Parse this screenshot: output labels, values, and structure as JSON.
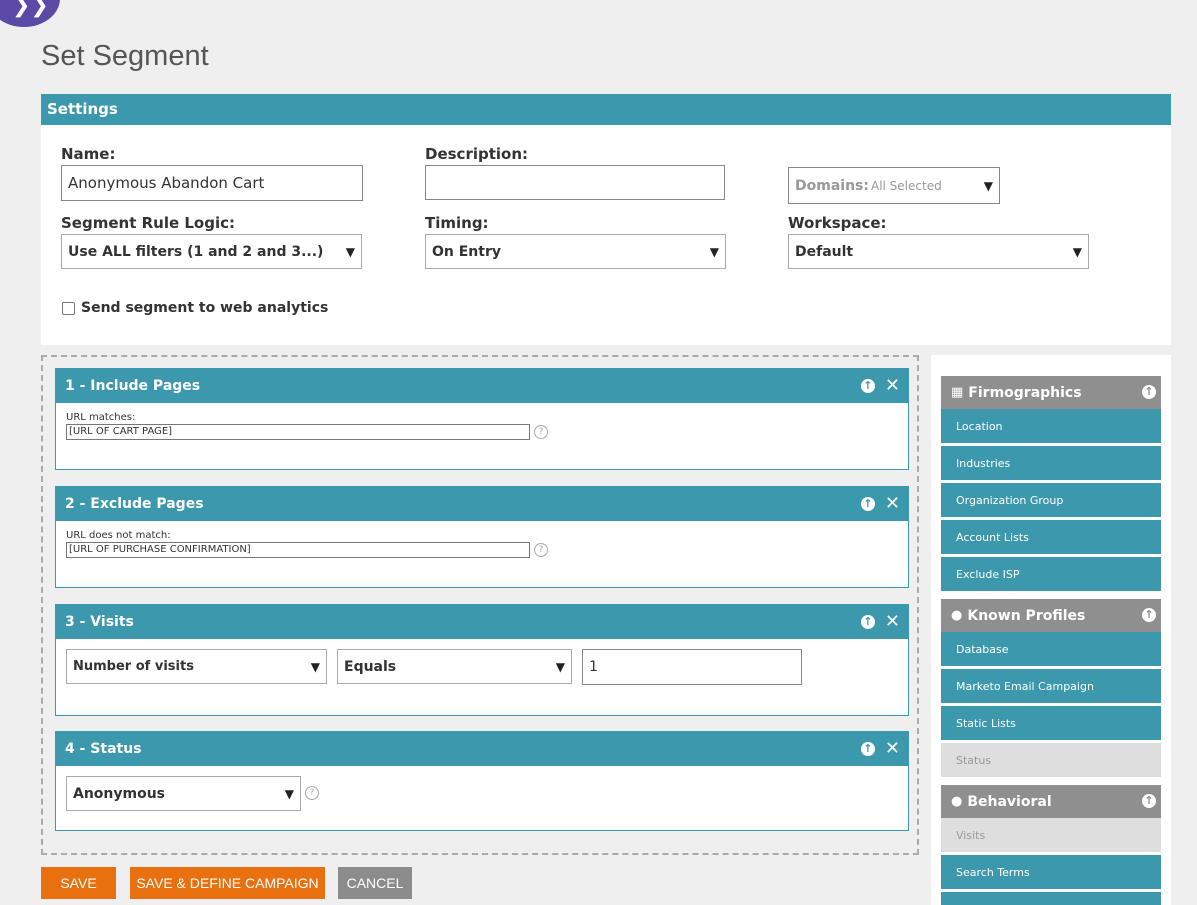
{
  "page": {
    "title": "Set Segment"
  },
  "settings": {
    "header": "Settings",
    "name_label": "Name:",
    "name_value": "Anonymous Abandon Cart",
    "description_label": "Description:",
    "description_value": "",
    "domains_label": "Domains:",
    "domains_value": "All Selected",
    "rule_logic_label": "Segment Rule Logic:",
    "rule_logic_value": "Use ALL filters (1 and 2 and 3...)",
    "timing_label": "Timing:",
    "timing_value": "On Entry",
    "workspace_label": "Workspace:",
    "workspace_value": "Default",
    "web_analytics_label": "Send segment to web analytics",
    "web_analytics_checked": false
  },
  "filters": [
    {
      "title": "1 - Include Pages",
      "field_label": "URL matches:",
      "field_value": "[URL OF CART PAGE]"
    },
    {
      "title": "2 - Exclude Pages",
      "field_label": "URL does not match:",
      "field_value": "[URL OF PURCHASE CONFIRMATION]"
    },
    {
      "title": "3 - Visits",
      "metric": "Number of visits",
      "operator": "Equals",
      "value": "1"
    },
    {
      "title": "4 - Status",
      "status": "Anonymous"
    }
  ],
  "buttons": {
    "save": "SAVE",
    "save_define": "SAVE & DEFINE CAMPAIGN",
    "cancel": "CANCEL"
  },
  "sidebar": {
    "sections": [
      {
        "title": "Firmographics",
        "icon": "building-icon",
        "items": [
          {
            "label": "Location",
            "enabled": true
          },
          {
            "label": "Industries",
            "enabled": true
          },
          {
            "label": "Organization Group",
            "enabled": true
          },
          {
            "label": "Account Lists",
            "enabled": true
          },
          {
            "label": "Exclude ISP",
            "enabled": true
          }
        ]
      },
      {
        "title": "Known Profiles",
        "icon": "person-icon",
        "items": [
          {
            "label": "Database",
            "enabled": true
          },
          {
            "label": "Marketo Email Campaign",
            "enabled": true
          },
          {
            "label": "Static Lists",
            "enabled": true
          },
          {
            "label": "Status",
            "enabled": false
          }
        ]
      },
      {
        "title": "Behavioral",
        "icon": "people-icon",
        "items": [
          {
            "label": "Visits",
            "enabled": false
          },
          {
            "label": "Search Terms",
            "enabled": true
          }
        ]
      }
    ]
  },
  "colors": {
    "teal": "#3c98ad",
    "orange": "#e9700f",
    "grey": "#8f8f8f",
    "logo": "#5a4aa6"
  }
}
